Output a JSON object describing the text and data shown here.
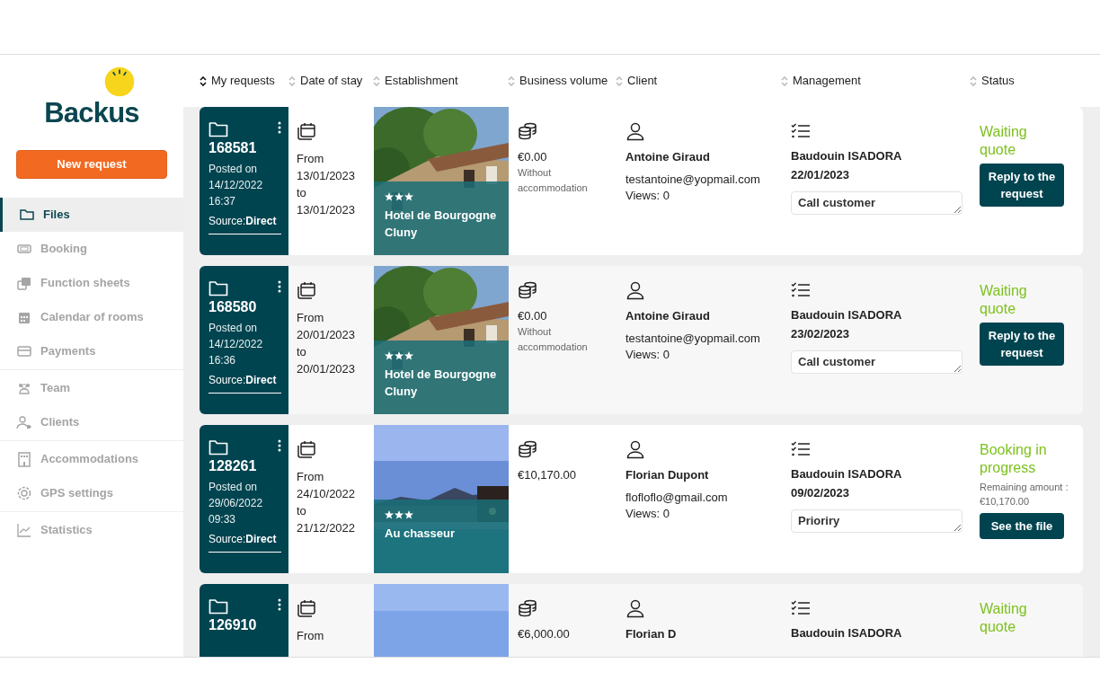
{
  "sidebar": {
    "logo": "Backus",
    "new_button": "New request",
    "groups": [
      [
        {
          "label": "Files",
          "selected": true
        },
        {
          "label": "Booking",
          "selected": false
        },
        {
          "label": "Function sheets",
          "selected": false
        },
        {
          "label": "Calendar of rooms",
          "selected": false
        },
        {
          "label": "Payments",
          "selected": false
        }
      ],
      [
        {
          "label": "Team",
          "selected": false
        },
        {
          "label": "Clients",
          "selected": false
        }
      ],
      [
        {
          "label": "Accommodations",
          "selected": false
        },
        {
          "label": "GPS settings",
          "selected": false
        }
      ],
      [
        {
          "label": "Statistics",
          "selected": false
        }
      ]
    ]
  },
  "table": {
    "columns": [
      {
        "label": "My requests",
        "sorted": true
      },
      {
        "label": "Date of stay",
        "sorted": false
      },
      {
        "label": "Establishment",
        "sorted": false
      },
      {
        "label": "Business volume",
        "sorted": false
      },
      {
        "label": "Client",
        "sorted": false
      },
      {
        "label": "Management",
        "sorted": false
      },
      {
        "label": "Status",
        "sorted": false
      }
    ],
    "rows": [
      {
        "id": "168581",
        "posted_label": "Posted on",
        "posted_date": "14/12/2022",
        "posted_time": "16:37",
        "source": "Source:**Direct**",
        "from_label": "From",
        "from": "13/01/2023",
        "to_label": "to",
        "to": "13/01/2023",
        "establishment": {
          "image": {
            "kind": "building"
          },
          "stars": 3,
          "name": "Hotel de Bourgogne Cluny"
        },
        "volume": "€0.00",
        "volume_note": "Without accommodation",
        "client": "Antoine Giraud",
        "email": "testantoine@yopmail.com",
        "views": "Views: 0",
        "manager": "Baudouin ISADORA",
        "manager_date": "22/01/2023",
        "note": "Call customer",
        "status": "Waiting quote",
        "action": "Reply to the request"
      },
      {
        "id": "168580",
        "posted_label": "Posted on",
        "posted_date": "14/12/2022",
        "posted_time": "16:36",
        "source": "Source:**Direct**",
        "from_label": "From",
        "from": "20/01/2023",
        "to_label": "to",
        "to": "20/01/2023",
        "establishment": {
          "image": {
            "kind": "building"
          },
          "stars": 3,
          "name": "Hotel de Bourgogne Cluny"
        },
        "volume": "€0.00",
        "volume_note": "Without accommodation",
        "client": "Antoine Giraud",
        "email": "testantoine@yopmail.com",
        "views": "Views: 0",
        "manager": "Baudouin ISADORA",
        "manager_date": "23/02/2023",
        "note": "Call customer",
        "status": "Waiting quote",
        "action": "Reply to the request"
      },
      {
        "id": "128261",
        "posted_label": "Posted on",
        "posted_date": "29/06/2022",
        "posted_time": "09:33",
        "source": "Source:**Direct**",
        "from_label": "From",
        "from": "24/10/2022",
        "to_label": "to",
        "to": "21/12/2022",
        "establishment": {
          "image": {
            "kind": "pool"
          },
          "stars": 3,
          "name": "Au chasseur"
        },
        "volume": "€10,170.00",
        "client": "Florian Dupont",
        "email": "flofloflo@gmail.com",
        "views": "Views: 0",
        "manager": "Baudouin ISADORA",
        "manager_date": "09/02/2023",
        "note": "Prioriry",
        "status": "Booking in progress",
        "remaining": "Remaining amount : €10,170.00",
        "action": "See the file"
      },
      {
        "id": "126910",
        "from_label": "From",
        "establishment": {
          "image": {
            "kind": "sky"
          }
        },
        "volume": "€6,000.00",
        "client": "Florian D",
        "manager": "Baudouin ISADORA",
        "status": "Waiting quote"
      }
    ]
  }
}
